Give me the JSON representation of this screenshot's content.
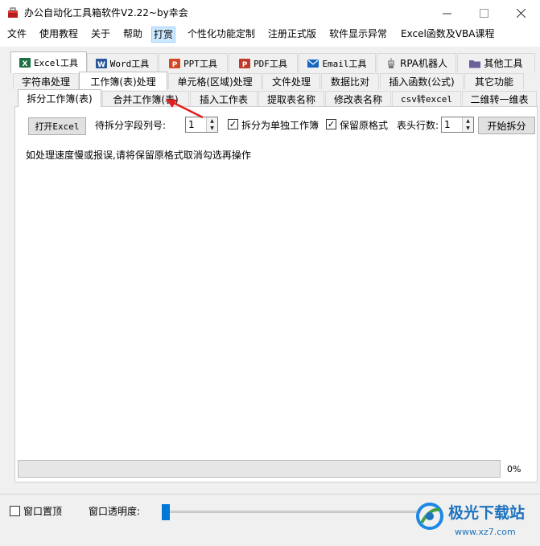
{
  "window": {
    "title": "办公自动化工具箱软件V2.22~by幸会",
    "minimize_icon": "minimize-icon",
    "maximize_icon": "maximize-icon",
    "close_icon": "close-icon"
  },
  "menu": [
    "文件",
    "使用教程",
    "关于",
    "帮助",
    "打赏",
    "个性化功能定制",
    "注册正式版",
    "软件显示异常",
    "Excel函数及VBA课程"
  ],
  "menu_active": "打赏",
  "tabs_row1": [
    {
      "label": "Excel工具",
      "icon": "excel-icon",
      "color": "#1d6f42"
    },
    {
      "label": "Word工具",
      "icon": "word-icon",
      "color": "#2b579a"
    },
    {
      "label": "PPT工具",
      "icon": "ppt-icon",
      "color": "#d24726"
    },
    {
      "label": "PDF工具",
      "icon": "pdf-icon",
      "color": "#c0392b"
    },
    {
      "label": "Email工具",
      "icon": "email-icon",
      "color": "#1565c0"
    },
    {
      "label": "RPA机器人",
      "icon": "robot-icon",
      "color": "#888888"
    },
    {
      "label": "其他工具",
      "icon": "folder-icon",
      "color": "#6d5f9a"
    }
  ],
  "tabs_row2": [
    "字符串处理",
    "工作簿(表)处理",
    "单元格(区域)处理",
    "文件处理",
    "数据比对",
    "插入函数(公式)",
    "其它功能"
  ],
  "tabs_row3": [
    "拆分工作簿(表)",
    "合并工作簿(表)",
    "插入工作表",
    "提取表名称",
    "修改表名称",
    "csv转excel",
    "二维转一维表"
  ],
  "content": {
    "open_excel_button": "打开Excel",
    "split_column_label": "待拆分字段列号:",
    "split_column_value": "1",
    "split_separate_label": "拆分为单独工作簿",
    "split_separate_checked": true,
    "keep_format_label": "保留原格式",
    "keep_format_checked": true,
    "header_rows_label": "表头行数:",
    "header_rows_value": "1",
    "start_split_button": "开始拆分",
    "hint_text": "如处理速度慢或报误,请将保留原格式取消勾选再操作"
  },
  "progress": {
    "value_percent": 0,
    "label": "0%",
    "fill_color": "#06b025"
  },
  "bottom": {
    "pin_label": "窗口置顶",
    "pin_checked": false,
    "opacity_label": "窗口透明度:",
    "opacity_value": 0
  },
  "watermark": {
    "title": "极光下载站",
    "url": "www.xz7.com"
  },
  "colors": {
    "accent": "#0078d7",
    "annotation": "#e02020",
    "panel_bg": "#f0f0f0"
  }
}
